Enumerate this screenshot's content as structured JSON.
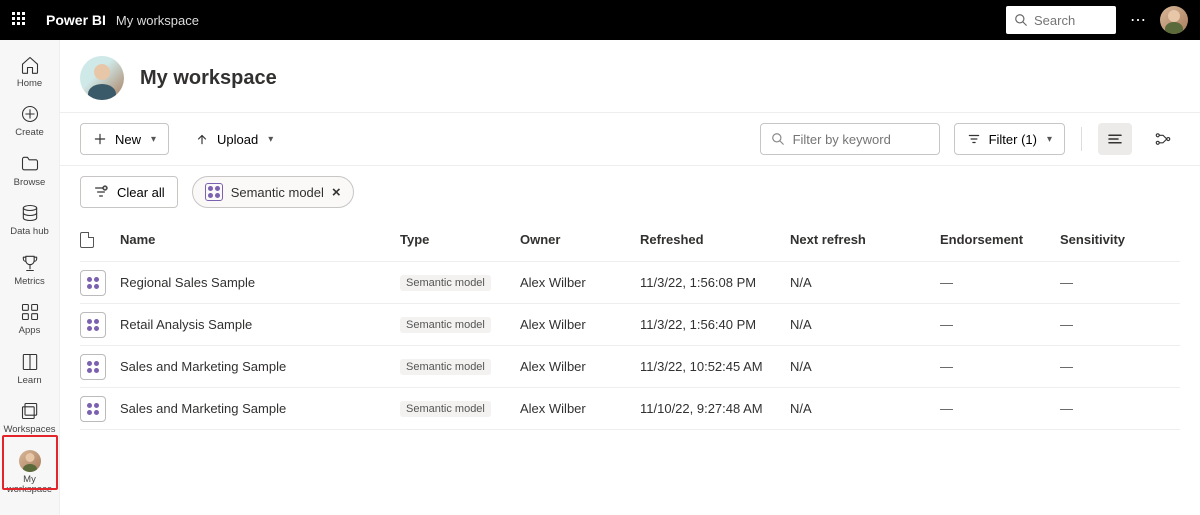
{
  "brand": "Power BI",
  "brand_sub": "My workspace",
  "search_placeholder": "Search",
  "nav": [
    {
      "label": "Home",
      "icon": "home"
    },
    {
      "label": "Create",
      "icon": "plus-circle"
    },
    {
      "label": "Browse",
      "icon": "folder"
    },
    {
      "label": "Data hub",
      "icon": "datahub"
    },
    {
      "label": "Metrics",
      "icon": "trophy"
    },
    {
      "label": "Apps",
      "icon": "apps"
    },
    {
      "label": "Learn",
      "icon": "book"
    },
    {
      "label": "Workspaces",
      "icon": "workspaces"
    },
    {
      "label": "My workspace",
      "icon": "avatar",
      "selected": true
    }
  ],
  "workspace_title": "My workspace",
  "toolbar": {
    "new_label": "New",
    "upload_label": "Upload",
    "filter_placeholder": "Filter by keyword",
    "filter_btn": "Filter (1)"
  },
  "chips": {
    "clear_all": "Clear all",
    "semantic_model": "Semantic model"
  },
  "columns": {
    "name": "Name",
    "type": "Type",
    "owner": "Owner",
    "refreshed": "Refreshed",
    "next_refresh": "Next refresh",
    "endorsement": "Endorsement",
    "sensitivity": "Sensitivity"
  },
  "rows": [
    {
      "name": "Regional Sales Sample",
      "type": "Semantic model",
      "owner": "Alex Wilber",
      "refreshed": "11/3/22, 1:56:08 PM",
      "next": "N/A",
      "endorsement": "—",
      "sensitivity": "—"
    },
    {
      "name": "Retail Analysis Sample",
      "type": "Semantic model",
      "owner": "Alex Wilber",
      "refreshed": "11/3/22, 1:56:40 PM",
      "next": "N/A",
      "endorsement": "—",
      "sensitivity": "—"
    },
    {
      "name": "Sales and Marketing Sample",
      "type": "Semantic model",
      "owner": "Alex Wilber",
      "refreshed": "11/3/22, 10:52:45 AM",
      "next": "N/A",
      "endorsement": "—",
      "sensitivity": "—"
    },
    {
      "name": "Sales and Marketing Sample",
      "type": "Semantic model",
      "owner": "Alex Wilber",
      "refreshed": "11/10/22, 9:27:48 AM",
      "next": "N/A",
      "endorsement": "—",
      "sensitivity": "—"
    }
  ]
}
